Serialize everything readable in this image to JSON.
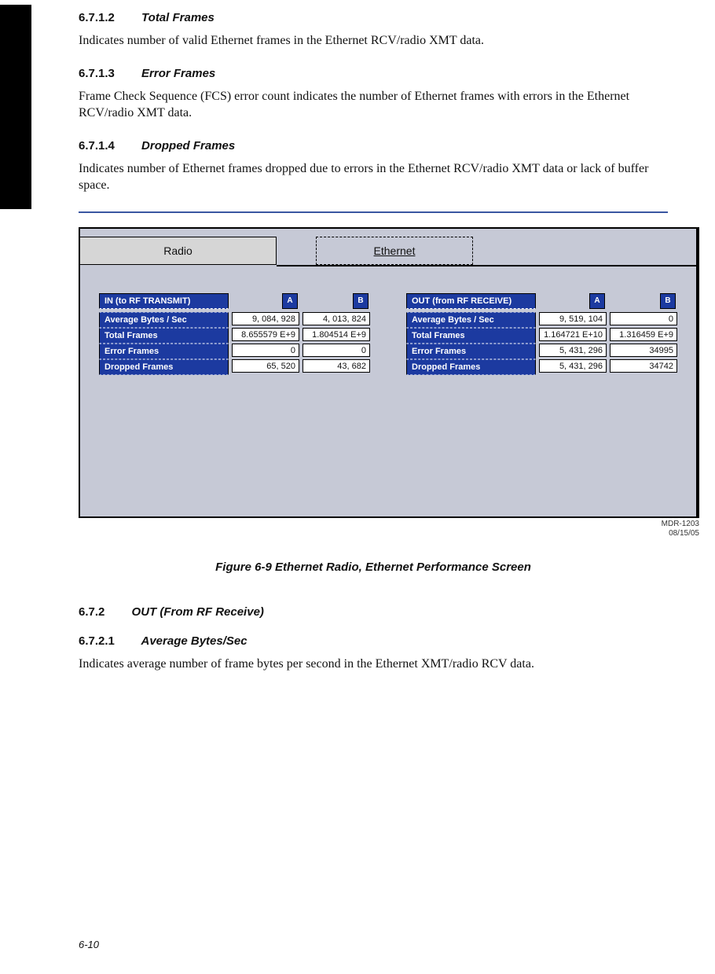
{
  "sections": {
    "s6712": {
      "num": "6.7.1.2",
      "title": "Total Frames",
      "body": "Indicates number of valid Ethernet frames in the Ethernet RCV/radio XMT data."
    },
    "s6713": {
      "num": "6.7.1.3",
      "title": "Error Frames",
      "body": "Frame Check Sequence (FCS) error count indicates the number of Ethernet frames with errors in the Ethernet RCV/radio XMT data."
    },
    "s6714": {
      "num": "6.7.1.4",
      "title": "Dropped Frames",
      "body": "Indicates number of Ethernet frames dropped due to errors in the Ethernet RCV/radio XMT data or lack of buffer space."
    },
    "s672": {
      "num": "6.7.2",
      "title": "OUT (From RF Receive)",
      "body": ""
    },
    "s6721": {
      "num": "6.7.2.1",
      "title": "Average Bytes/Sec",
      "body": "Indicates average number of frame bytes per second in the Ethernet XMT/radio RCV data."
    }
  },
  "tabs": {
    "radio": "Radio",
    "ethernet": "Ethernet"
  },
  "col": {
    "A": "A",
    "B": "B"
  },
  "labels": {
    "in_title": "IN (to RF TRANSMIT)",
    "out_title": "OUT (from RF RECEIVE)",
    "avg": "Average Bytes / Sec",
    "total": "Total Frames",
    "error": "Error Frames",
    "dropped": "Dropped Frames"
  },
  "chart_data": {
    "type": "table",
    "title": "Ethernet Radio, Ethernet Performance Screen",
    "series": [
      {
        "name": "IN (to RF TRANSMIT)",
        "categories": [
          "Average Bytes / Sec",
          "Total Frames",
          "Error Frames",
          "Dropped Frames"
        ],
        "A": [
          9084928,
          8655579000.0,
          0,
          65520
        ],
        "B": [
          4013824,
          1804514000.0,
          0,
          43682
        ]
      },
      {
        "name": "OUT (from RF RECEIVE)",
        "categories": [
          "Average Bytes / Sec",
          "Total Frames",
          "Error Frames",
          "Dropped Frames"
        ],
        "A": [
          9519104,
          11647210000.0,
          5431296,
          5431296
        ],
        "B": [
          0,
          1316459000.0,
          34995,
          34742
        ]
      }
    ]
  },
  "vals": {
    "in": {
      "avg": {
        "A": "9, 084, 928",
        "B": "4, 013, 824"
      },
      "total": {
        "A": "8.655579 E+9",
        "B": "1.804514 E+9"
      },
      "error": {
        "A": "0",
        "B": "0"
      },
      "dropped": {
        "A": "65, 520",
        "B": "43, 682"
      }
    },
    "out": {
      "avg": {
        "A": "9, 519, 104",
        "B": "0"
      },
      "total": {
        "A": "1.164721 E+10",
        "B": "1.316459 E+9"
      },
      "error": {
        "A": "5, 431, 296",
        "B": "34995"
      },
      "dropped": {
        "A": "5, 431, 296",
        "B": "34742"
      }
    }
  },
  "figure": {
    "meta1": "MDR-1203",
    "meta2": "08/15/05",
    "caption": "Figure 6-9   Ethernet Radio, Ethernet Performance Screen"
  },
  "page_num": "6-10"
}
